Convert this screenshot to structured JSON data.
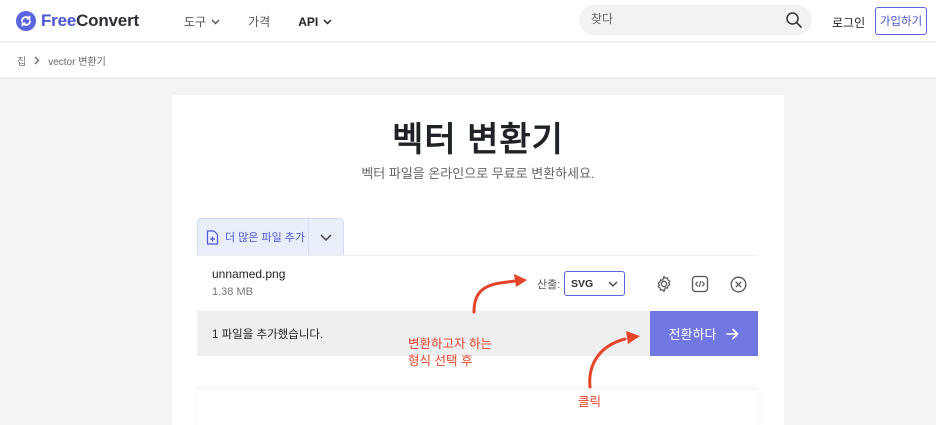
{
  "header": {
    "logo": {
      "free": "Free",
      "convert": "Convert"
    },
    "nav": [
      {
        "label": "도구",
        "dropdown": true,
        "strong": false
      },
      {
        "label": "가격",
        "dropdown": false,
        "strong": false
      },
      {
        "label": "API",
        "dropdown": true,
        "strong": true
      }
    ],
    "search": {
      "placeholder": "찾다"
    },
    "login": "로그인",
    "signup": "가입하기"
  },
  "breadcrumb": {
    "home": "집",
    "current": "vector 변환기"
  },
  "main": {
    "title": "벡터 변환기",
    "subtitle": "벡터 파일을 온라인으로 무료로 변환하세요.",
    "add_more": "더 많은 파일 추가",
    "file": {
      "name": "unnamed.png",
      "size": "1.38 MB"
    },
    "output": {
      "label": "산출:",
      "selected": "SVG"
    },
    "status": "1 파일을 추가했습니다.",
    "convert": "전환하다"
  },
  "annotations": {
    "line1": "변환하고자 하는",
    "line2": "형식 선택 후",
    "click": "클릭",
    "color": "#e4442a"
  },
  "colors": {
    "brand": "#4b55d8",
    "convert_button": "#7178e4"
  }
}
